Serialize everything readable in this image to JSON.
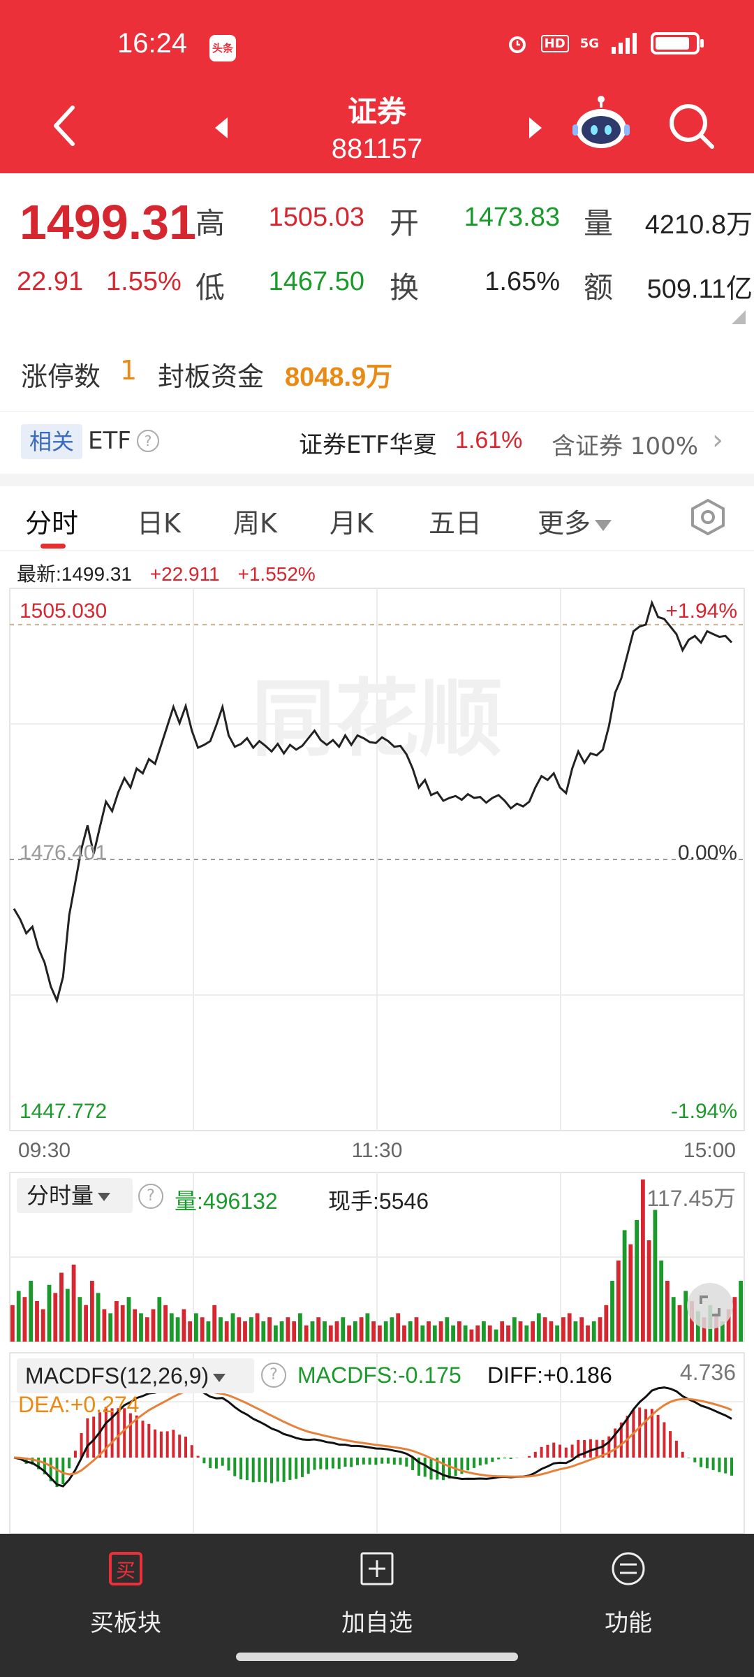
{
  "status": {
    "time": "16:24",
    "app_badge": "头条",
    "hd": "HD",
    "net": "5G"
  },
  "nav": {
    "title": "证券",
    "code": "881157"
  },
  "quote": {
    "price": "1499.31",
    "change": "22.91",
    "pct": "1.55%",
    "high_label": "高",
    "high": "1505.03",
    "open_label": "开",
    "open": "1473.83",
    "vol_label": "量",
    "vol": "4210.8万",
    "low_label": "低",
    "low": "1467.50",
    "turn_label": "换",
    "turn": "1.65%",
    "amt_label": "额",
    "amt": "509.11亿",
    "limit_up_label": "涨停数",
    "limit_up": "1",
    "seal_label": "封板资金",
    "seal": "8048.9万"
  },
  "etf": {
    "badge": "相关",
    "label": "ETF",
    "name": "证券ETF华夏",
    "pct": "1.61%",
    "contain": "含证券 100%"
  },
  "tabs": [
    {
      "label": "分时"
    },
    {
      "label": "日K"
    },
    {
      "label": "周K"
    },
    {
      "label": "月K"
    },
    {
      "label": "五日"
    },
    {
      "label": "更多"
    }
  ],
  "chart_data": {
    "type": "line",
    "latest_label": "最新:1499.31",
    "latest_change": "+22.911",
    "latest_pct": "+1.552%",
    "y_top": "1505.030",
    "y_mid": "1476.401",
    "y_bot": "1447.772",
    "pct_top": "+1.94%",
    "pct_mid": "0.00%",
    "pct_bot": "-1.94%",
    "ylim": [
      1447.772,
      1505.03
    ],
    "x_ticks": [
      "09:30",
      "11:30",
      "15:00"
    ],
    "reference_line": 1476.401,
    "prices": [
      1471.2,
      1470.1,
      1468.6,
      1469.3,
      1467.0,
      1465.5,
      1463.0,
      1461.5,
      1464.0,
      1470.5,
      1474.0,
      1477.5,
      1480.0,
      1477.0,
      1479.8,
      1482.5,
      1481.5,
      1483.5,
      1485.0,
      1484.0,
      1486.0,
      1485.5,
      1487.0,
      1486.5,
      1488.5,
      1490.5,
      1492.5,
      1490.8,
      1492.6,
      1490.0,
      1488.2,
      1488.5,
      1488.9,
      1490.6,
      1492.5,
      1489.5,
      1488.3,
      1488.6,
      1489.2,
      1488.2,
      1488.9,
      1488.4,
      1487.8,
      1488.6,
      1487.6,
      1488.5,
      1488.0,
      1488.4,
      1489.2,
      1490.0,
      1489.0,
      1488.5,
      1489.0,
      1488.3,
      1489.5,
      1488.5,
      1489.5,
      1489.2,
      1488.8,
      1488.7,
      1489.3,
      1488.9,
      1488.3,
      1488.4,
      1487.5,
      1486.0,
      1484.0,
      1484.8,
      1483.2,
      1483.5,
      1482.6,
      1482.9,
      1483.1,
      1482.7,
      1483.3,
      1482.9,
      1483.0,
      1482.4,
      1482.9,
      1483.2,
      1482.6,
      1481.8,
      1482.3,
      1482.0,
      1482.5,
      1484.0,
      1485.2,
      1484.8,
      1485.5,
      1484.0,
      1483.4,
      1486.0,
      1487.8,
      1486.6,
      1487.6,
      1487.4,
      1488.0,
      1490.5,
      1494.0,
      1495.5,
      1498.0,
      1500.5,
      1501.0,
      1501.2,
      1503.5,
      1502.0,
      1501.8,
      1501.0,
      1500.2,
      1498.5,
      1499.6,
      1500.0,
      1499.3,
      1500.5,
      1500.2,
      1499.9,
      1500.0,
      1499.31
    ],
    "volume_label": "量:496132",
    "hand_label": "现手:5546",
    "volume_max": "117.45万",
    "volumes": [
      18,
      25,
      22,
      30,
      20,
      16,
      28,
      24,
      34,
      26,
      38,
      22,
      18,
      30,
      24,
      16,
      14,
      20,
      18,
      22,
      16,
      14,
      12,
      16,
      22,
      18,
      14,
      12,
      16,
      10,
      14,
      12,
      10,
      18,
      12,
      10,
      14,
      12,
      10,
      12,
      14,
      10,
      12,
      8,
      10,
      12,
      10,
      14,
      8,
      10,
      12,
      10,
      8,
      10,
      12,
      8,
      10,
      12,
      14,
      10,
      8,
      10,
      12,
      14,
      8,
      10,
      12,
      8,
      10,
      8,
      10,
      12,
      8,
      10,
      8,
      6,
      8,
      10,
      8,
      6,
      10,
      8,
      12,
      10,
      8,
      10,
      14,
      12,
      10,
      8,
      12,
      14,
      10,
      12,
      8,
      10,
      12,
      18,
      30,
      40,
      55,
      48,
      60,
      80,
      50,
      65,
      40,
      30,
      22,
      18,
      25,
      20,
      15,
      12,
      18,
      14,
      10,
      16,
      22,
      30
    ],
    "vol_up": [
      true,
      false,
      true,
      false,
      true,
      true,
      false,
      true,
      true,
      false,
      true,
      false,
      true,
      true,
      false,
      true,
      false,
      true,
      true,
      false,
      true,
      false,
      true,
      true,
      false,
      true,
      false,
      false,
      true,
      true,
      false,
      true,
      false,
      true,
      false,
      true,
      false,
      true,
      true,
      false,
      true,
      false,
      true,
      false,
      false,
      true,
      true,
      false,
      true,
      false,
      true,
      false,
      true,
      true,
      false,
      true,
      false,
      true,
      false,
      true,
      true,
      false,
      false,
      true,
      true,
      false,
      true,
      false,
      true,
      false,
      true,
      false,
      false,
      true,
      false,
      true,
      true,
      false,
      true,
      false,
      true,
      true,
      false,
      true,
      false,
      true,
      false,
      true,
      true,
      false,
      true,
      true,
      false,
      true,
      true,
      false,
      true,
      true,
      false,
      true,
      false,
      true,
      false,
      true,
      true,
      false,
      false,
      true,
      false,
      true,
      false,
      true,
      false,
      true,
      false,
      true,
      false,
      true,
      true,
      false
    ],
    "macd_title": "MACDFS(12,26,9)",
    "macd_value": "MACDFS:-0.175",
    "diff_value": "DIFF:+0.186",
    "dea_value": "DEA:+0.274",
    "macd_max": "4.736"
  },
  "bottom_nav": [
    {
      "label": "买板块",
      "icon": "buy-icon"
    },
    {
      "label": "加自选",
      "icon": "add-watchlist-icon"
    },
    {
      "label": "功能",
      "icon": "menu-icon"
    }
  ],
  "colors": {
    "header": "#ec303a",
    "up": "#d6262f",
    "down": "#1a9a2a",
    "accent": "#e88a14"
  }
}
